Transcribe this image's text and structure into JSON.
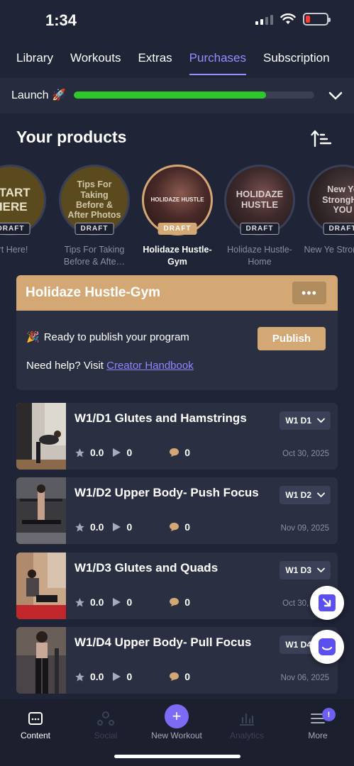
{
  "status_bar": {
    "time": "1:34"
  },
  "top_tabs": [
    {
      "label": "Library",
      "active": false
    },
    {
      "label": "Workouts",
      "active": false
    },
    {
      "label": "Extras",
      "active": false
    },
    {
      "label": "Purchases",
      "active": true
    },
    {
      "label": "Subscription",
      "active": false
    }
  ],
  "launch": {
    "label": "Launch 🚀",
    "progress_percent": 80
  },
  "products_section": {
    "title": "Your products"
  },
  "products": [
    {
      "circle_text": "START HERE",
      "badge": "DRAFT",
      "name": "Start Here!",
      "name_display": "art Here!",
      "active": false
    },
    {
      "circle_text": "Tips For Taking Before & After Photos",
      "badge": "DRAFT",
      "name": "Tips For Taking Before & Afte…",
      "active": false
    },
    {
      "circle_text": "HOLIDAZE HUSTLE",
      "badge": "DRAFT",
      "name": "Holidaze Hustle-Gym",
      "active": true
    },
    {
      "circle_text": "HOLIDAZE HUSTLE",
      "badge": "DRAFT",
      "name": "Holidaze Hustle-Home",
      "active": false
    },
    {
      "circle_text": "New Ye StrongHE YOU",
      "badge": "DRAFT",
      "name": "New Ye StrongHER",
      "active": false
    }
  ],
  "program": {
    "title": "Holidaze Hustle-Gym",
    "more_label": "•••",
    "ready_text": "Ready to publish your program",
    "ready_emoji": "🎉",
    "publish_label": "Publish",
    "help_prefix": "Need help? Visit",
    "help_link": "Creator Handbook"
  },
  "workouts": [
    {
      "title": "W1/D1 Glutes and Hamstrings",
      "day": "W1 D1",
      "rating": "0.0",
      "plays": "0",
      "comments": "0",
      "date": "Oct 30, 2025"
    },
    {
      "title": "W1/D2 Upper Body- Push Focus",
      "day": "W1 D2",
      "rating": "0.0",
      "plays": "0",
      "comments": "0",
      "date": "Nov 09, 2025"
    },
    {
      "title": "W1/D3 Glutes and Quads",
      "day": "W1 D3",
      "rating": "0.0",
      "plays": "0",
      "comments": "0",
      "date": "Oct 30, 2025"
    },
    {
      "title": "W1/D4 Upper Body- Pull Focus",
      "day": "W1 D4",
      "rating": "0.0",
      "plays": "0",
      "comments": "0",
      "date": "Nov 06, 2025"
    }
  ],
  "bottom_nav": [
    {
      "label": "Content",
      "active": true,
      "disabled": false
    },
    {
      "label": "Social",
      "active": false,
      "disabled": true
    },
    {
      "label": "New Workout",
      "active": false,
      "disabled": false
    },
    {
      "label": "Analytics",
      "active": false,
      "disabled": true
    },
    {
      "label": "More",
      "active": false,
      "disabled": false,
      "badge": "!"
    }
  ],
  "colors": {
    "background": "#1f2436",
    "card": "#2a2f42",
    "accent_gold": "#d3a875",
    "accent_purple": "#9c8cff",
    "progress_green": "#2ec72e"
  }
}
